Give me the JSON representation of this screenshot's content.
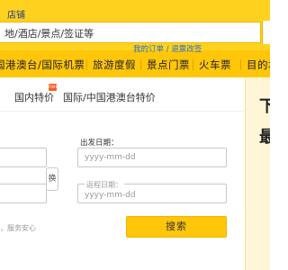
{
  "header": {
    "store_label": "店铺",
    "search_placeholder": "地/酒店/景点/签证等"
  },
  "nav": {
    "items": [
      "国港澳台/国际机票",
      "旅游度假",
      "景点门票",
      "火车票",
      "目的地"
    ]
  },
  "tabs": {
    "items": [
      "国内特价",
      "国际/中国港澳台特价"
    ],
    "badge": "new"
  },
  "links": {
    "orders": "我的订单 / 退票改签"
  },
  "form": {
    "depart_label": "出发日期：",
    "date_placeholder": "yyyy-mm-dd",
    "return_label": "返程日期：",
    "return_placeholder": "yyyy-mm-dd",
    "swap_label": "换"
  },
  "service_text": "，服务安心",
  "search_button": "搜索",
  "promo": {
    "char1": "下",
    "char2": "最"
  },
  "colors": {
    "brand_yellow": "#ffd21f",
    "nav_yellow": "#ffc60a",
    "link_blue": "#1f6ed4"
  }
}
